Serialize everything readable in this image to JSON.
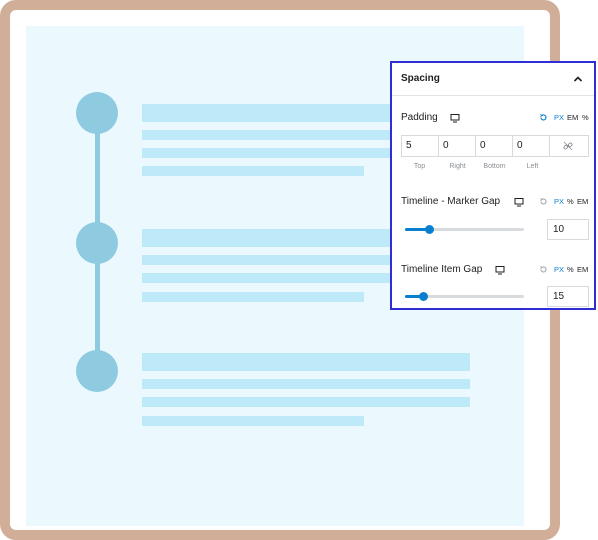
{
  "panel": {
    "title": "Spacing",
    "padding": {
      "label": "Padding",
      "units": [
        "PX",
        "EM",
        "%"
      ],
      "active_unit": "PX",
      "values": [
        "5",
        "0",
        "0",
        "0"
      ],
      "sides": [
        "Top",
        "Right",
        "Bottom",
        "Left"
      ]
    },
    "marker_gap": {
      "label": "Timeline - Marker Gap",
      "units": [
        "PX",
        "%",
        "EM"
      ],
      "active_unit": "PX",
      "value": "10",
      "slider_fraction": 0.2
    },
    "item_gap": {
      "label": "Timeline Item Gap",
      "units": [
        "PX",
        "%",
        "EM"
      ],
      "active_unit": "PX",
      "value": "15",
      "slider_fraction": 0.15
    }
  },
  "colors": {
    "accent": "#0a7fcf",
    "panel_border": "#2f2ed6",
    "timeline_marker": "#8ecbe0",
    "placeholder_bar": "#bde9f8",
    "canvas_bg": "#ebf8fe",
    "frame": "#d1ae98"
  },
  "icons": [
    "desktop-icon",
    "reset-icon",
    "link-icon",
    "chevron-up-icon"
  ]
}
